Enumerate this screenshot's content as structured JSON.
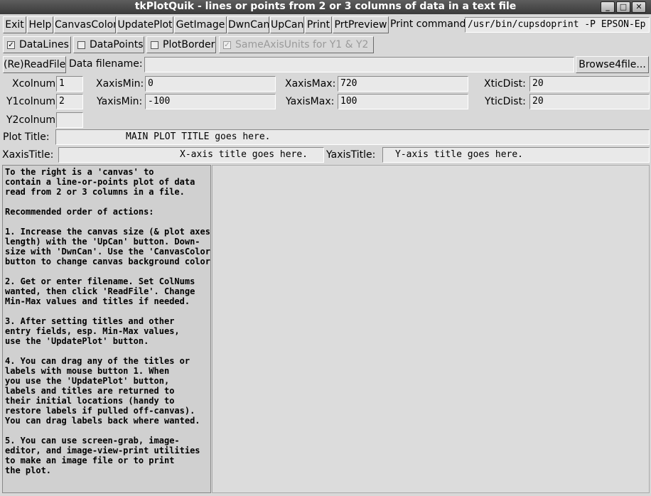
{
  "window": {
    "title": "tkPlotQuik - lines or points from 2 or 3 columns of data in a text file",
    "min_glyph": "_",
    "max_glyph": "□",
    "close_glyph": "✕"
  },
  "toolbar": {
    "exit": "Exit",
    "help": "Help",
    "canvas_color": "CanvasColor",
    "update_plot": "UpdatePlot",
    "get_image": "GetImage",
    "dwn_can": "DwnCan",
    "up_can": "UpCan",
    "print": "Print",
    "prt_preview": "PrtPreview",
    "print_command_label": "Print command:",
    "print_command_value": "/usr/bin/cupsdoprint -P EPSON-Ep"
  },
  "options": {
    "datalines": {
      "label": "DataLines",
      "checked": true
    },
    "datapoints": {
      "label": "DataPoints",
      "checked": false
    },
    "plotborder": {
      "label": "PlotBorder",
      "checked": false
    },
    "sameaxis": {
      "label": "SameAxisUnits for Y1 & Y2",
      "checked": true,
      "disabled": true
    }
  },
  "file": {
    "readfile_button": "(Re)ReadFile",
    "filename_label": "Data filename:",
    "filename_value": "",
    "browse_button": "Browse4file..."
  },
  "params": {
    "xcolnum_label": "Xcolnum:",
    "xcolnum": "1",
    "y1colnum_label": "Y1colnum:",
    "y1colnum": "2",
    "y2colnum_label": "Y2colnum:",
    "y2colnum": "",
    "xaxismin_label": "XaxisMin:",
    "xaxismin": "0",
    "yaxismin_label": "YaxisMin:",
    "yaxismin": "-100",
    "xaxismax_label": "XaxisMax:",
    "xaxismax": "720",
    "yaxismax_label": "YaxisMax:",
    "yaxismax": "100",
    "xticdist_label": "XticDist:",
    "xticdist": "20",
    "yticdist_label": "YticDist:",
    "yticdist": "20"
  },
  "titles": {
    "plot_title_label": "Plot Title:",
    "plot_title": "MAIN PLOT TITLE goes here.",
    "xaxis_title_label": "XaxisTitle:",
    "xaxis_title": "X-axis title goes here.",
    "yaxis_title_label": "YaxisTitle:",
    "yaxis_title": "Y-axis title goes here."
  },
  "help_text": "To the right is a 'canvas' to\ncontain a line-or-points plot of data\nread from 2 or 3 columns in a file.\n\nRecommended order of actions:\n\n1. Increase the canvas size (& plot axes\nlength) with the 'UpCan' button. Down-\nsize with 'DwnCan'. Use the 'CanvasColor'\nbutton to change canvas background color.\n\n2. Get or enter filename. Set ColNums\nwanted, then click 'ReadFile'. Change\nMin-Max values and titles if needed.\n\n3. After setting titles and other\nentry fields, esp. Min-Max values,\nuse the 'UpdatePlot' button.\n\n4. You can drag any of the titles or\nlabels with mouse button 1. When\nyou use the 'UpdatePlot' button,\nlabels and titles are returned to\ntheir initial locations (handy to\nrestore labels if pulled off-canvas).\nYou can drag labels back where wanted.\n\n5. You can use screen-grab, image-\neditor, and image-view-print utilities\nto make an image file or to print\nthe plot."
}
